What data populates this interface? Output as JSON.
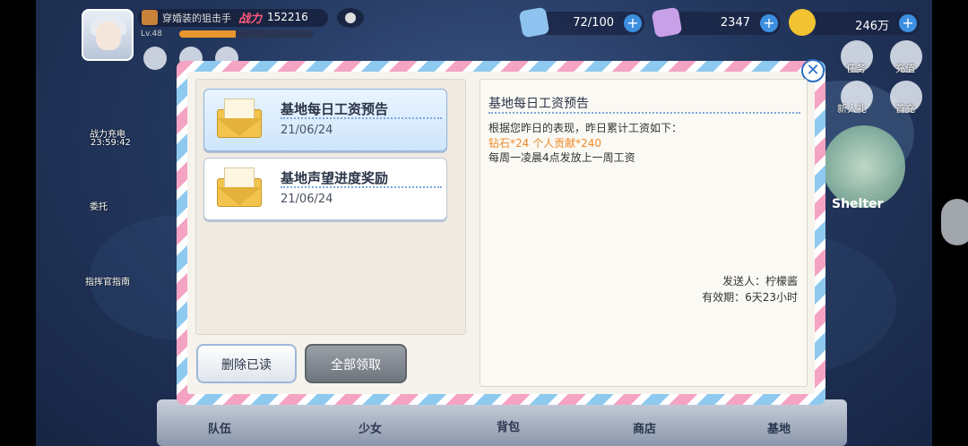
{
  "player": {
    "name": "穿婚装的狙击手",
    "power_label": "战力",
    "power_value": "152216",
    "level": "Lv.48",
    "exp_fraction": 0.42
  },
  "resources": [
    {
      "name": "stamina",
      "value": "72/100",
      "icon": "stamina-card-icon",
      "color": "#8ec3ef"
    },
    {
      "name": "diamond",
      "value": "2347",
      "icon": "diamond-icon",
      "color": "#c7a0e8"
    },
    {
      "name": "gold",
      "value": "246万",
      "icon": "gold-coin-icon",
      "color": "#f1c232"
    }
  ],
  "right_menu": {
    "task": "任务",
    "recharge": "充值",
    "newbie_gift": "新人礼",
    "first_recharge": "首充",
    "shelter": "Shelter"
  },
  "left_menu": {
    "power_charge": "战力充电",
    "power_charge_timer": "23:59:42",
    "quest": "委托",
    "commander_guide": "指挥官指南"
  },
  "bottom_nav": [
    "队伍",
    "少女",
    "背包",
    "商店",
    "基地"
  ],
  "mail": {
    "items": [
      {
        "title": "基地每日工资预告",
        "date": "21/06/24",
        "selected": true
      },
      {
        "title": "基地声望进度奖励",
        "date": "21/06/24",
        "selected": false
      }
    ],
    "detail": {
      "title": "基地每日工资预告",
      "line1": "根据您昨日的表现，昨日累计工资如下：",
      "reward": "钻石*24   个人贡献*240",
      "line2": "每周一凌晨4点发放上一周工资",
      "sender": "发送人：柠檬酱",
      "expire": "有效期：6天23小时"
    },
    "buttons": {
      "delete_read": "删除已读",
      "claim_all": "全部领取"
    },
    "close": "✕"
  }
}
